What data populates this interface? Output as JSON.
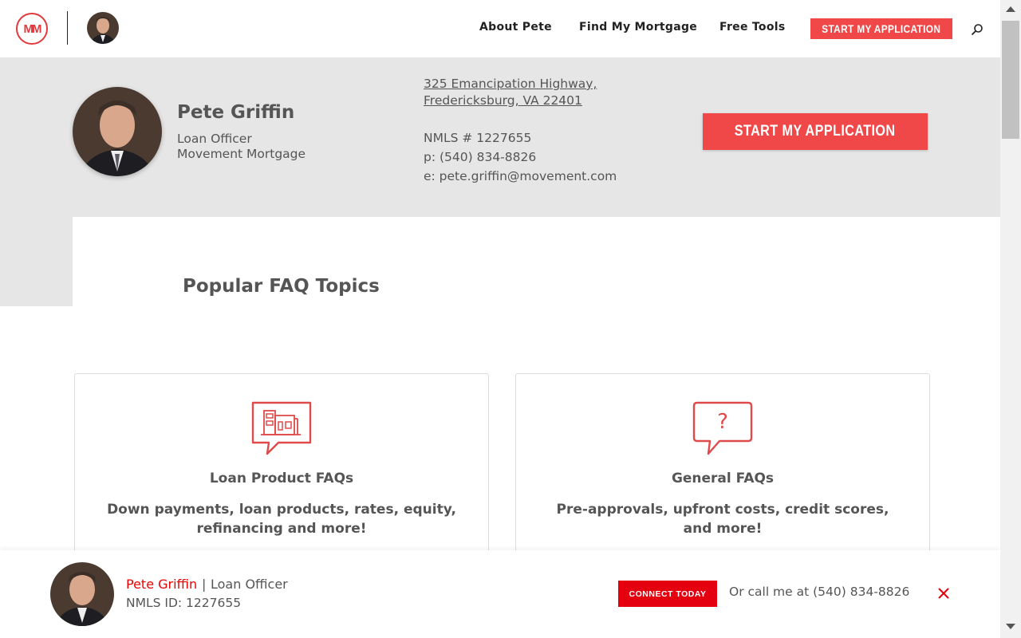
{
  "nav": {
    "logo_text": "MM",
    "links": [
      "About Pete",
      "Find My Mortgage",
      "Free Tools"
    ],
    "cta_label": "START MY APPLICATION",
    "icons": {
      "search": "search-icon"
    }
  },
  "profile": {
    "name": "Pete Griffin",
    "title": "Loan Officer",
    "company": "Movement Mortgage",
    "address_line1": "325 Emancipation Highway,",
    "address_line2": "Fredericksburg, VA 22401",
    "nmls": "NMLS # 1227655",
    "phone": "p: (540) 834-8826",
    "email": "e: pete.griffin@movement.com",
    "cta_label": "START MY APPLICATION"
  },
  "faq": {
    "heading": "Popular FAQ Topics",
    "cards": [
      {
        "title": "Loan Product FAQs",
        "desc": "Down payments, loan products, rates, equity, refinancing and more!",
        "icon": "buildings-chat-icon"
      },
      {
        "title": "General FAQs",
        "desc": "Pre-approvals, upfront costs, credit scores, and more!",
        "icon": "question-chat-icon"
      }
    ]
  },
  "bottombar": {
    "name": "Pete Griffin",
    "separator": "|",
    "role": "Loan Officer",
    "nmls": "NMLS ID: 1227655",
    "cta_label": "CONNECT TODAY",
    "call_text": "Or call me at (540) 834-8826"
  },
  "colors": {
    "accent": "#f04748",
    "accent_dark": "#e4000f",
    "hero_bg": "#e6e6e6",
    "text": "#555555"
  }
}
